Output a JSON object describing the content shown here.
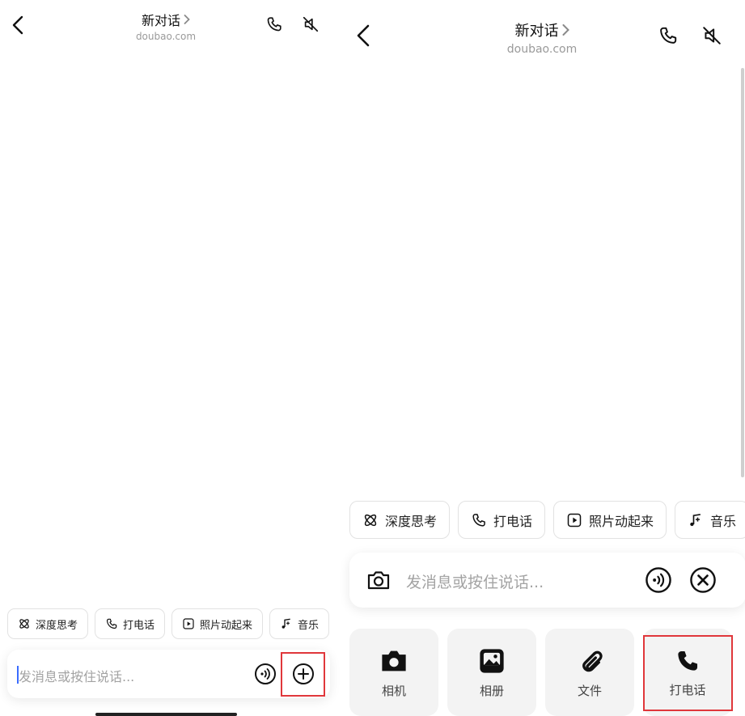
{
  "left": {
    "header": {
      "title": "新对话",
      "subtitle": "doubao.com"
    },
    "chips": [
      {
        "icon": "atom-icon",
        "label": "深度思考"
      },
      {
        "icon": "phone-icon",
        "label": "打电话"
      },
      {
        "icon": "play-icon",
        "label": "照片动起来"
      },
      {
        "icon": "music-note-icon",
        "label": "音乐"
      }
    ],
    "input": {
      "placeholder": "发消息或按住说话..."
    }
  },
  "right": {
    "header": {
      "title": "新对话",
      "subtitle": "doubao.com"
    },
    "chips": [
      {
        "icon": "atom-icon",
        "label": "深度思考"
      },
      {
        "icon": "phone-icon",
        "label": "打电话"
      },
      {
        "icon": "play-icon",
        "label": "照片动起来"
      },
      {
        "icon": "music-note-icon",
        "label": "音乐"
      }
    ],
    "input": {
      "placeholder": "发消息或按住说话..."
    },
    "tiles": [
      {
        "icon": "camera-icon",
        "label": "相机"
      },
      {
        "icon": "image-icon",
        "label": "相册"
      },
      {
        "icon": "paperclip-icon",
        "label": "文件"
      },
      {
        "icon": "phone-icon",
        "label": "打电话"
      }
    ]
  },
  "colors": {
    "highlight": "#e0373b",
    "placeholder": "#a3a3a3",
    "subtitle": "#9a9a9a"
  }
}
